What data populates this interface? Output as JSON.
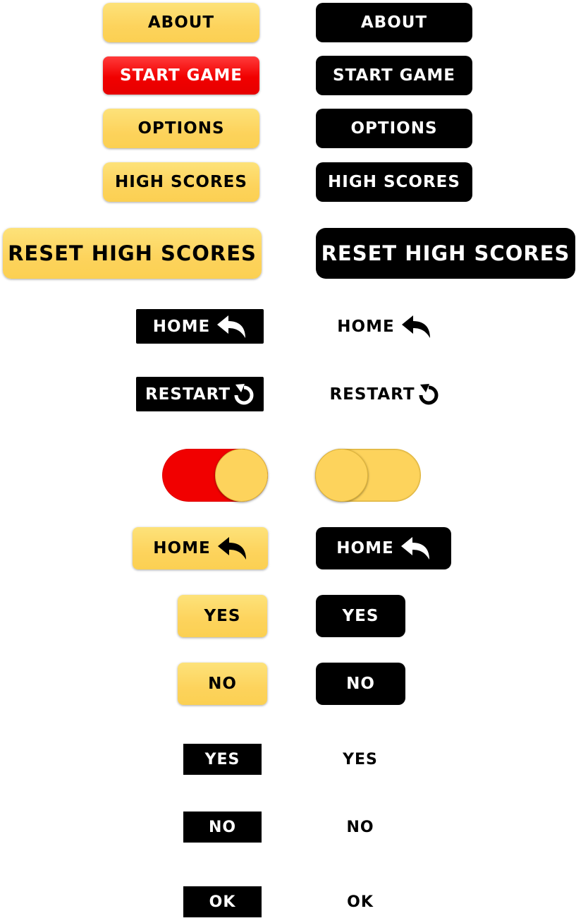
{
  "colors": {
    "yellow": "#fdd35c",
    "red": "#f10000",
    "black": "#000000",
    "white": "#ffffff"
  },
  "menu": {
    "about": "ABOUT",
    "start_game": "START GAME",
    "options": "OPTIONS",
    "high_scores": "HIGH SCORES",
    "reset_high_scores": "RESET HIGH SCORES"
  },
  "nav": {
    "home": "HOME",
    "restart": "RESTART"
  },
  "toggles": {
    "on_state": {
      "color": "#f10000",
      "state": "on"
    },
    "off_state": {
      "color": "#fdd35c",
      "state": "off"
    }
  },
  "dialog": {
    "home": "HOME",
    "yes": "YES",
    "no": "NO",
    "ok": "OK"
  },
  "icons": {
    "home": "undo-arrow-icon",
    "restart": "restart-circular-arrow-icon"
  }
}
